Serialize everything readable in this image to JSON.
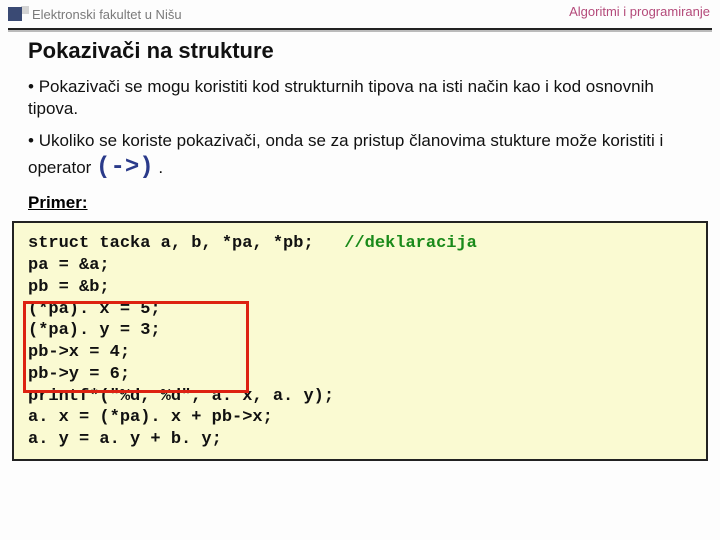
{
  "header": {
    "left": "Elektronski fakultet u Nišu",
    "right": "Algoritmi i programiranje"
  },
  "title": "Pokazivači na strukture",
  "bullets": {
    "b1": "Pokazivači se mogu koristiti kod strukturnih tipova na isti način kao i kod osnovnih tipova.",
    "b2a": "Ukoliko se koriste pokazivači, onda se za pristup članovima stukture može koristiti i operator ",
    "op": "(->)",
    "b2b": " ."
  },
  "primer_label": "Primer:",
  "code": {
    "l1a": "struct tacka a, b, *pa, *pb;   ",
    "l1b": "//deklaracija",
    "l2": "pa = &a;",
    "l3": "pb = &b;",
    "l4": "(*pa). x = 5;",
    "l5": "(*pa). y = 3;",
    "l6": "pb->x = 4;",
    "l7": "pb->y = 6;",
    "l8": "printf*(\"%d, %d\", a. x, a. y);",
    "l9": "a. x = (*pa). x + pb->x;",
    "l10": "a. y = a. y + b. y;"
  }
}
